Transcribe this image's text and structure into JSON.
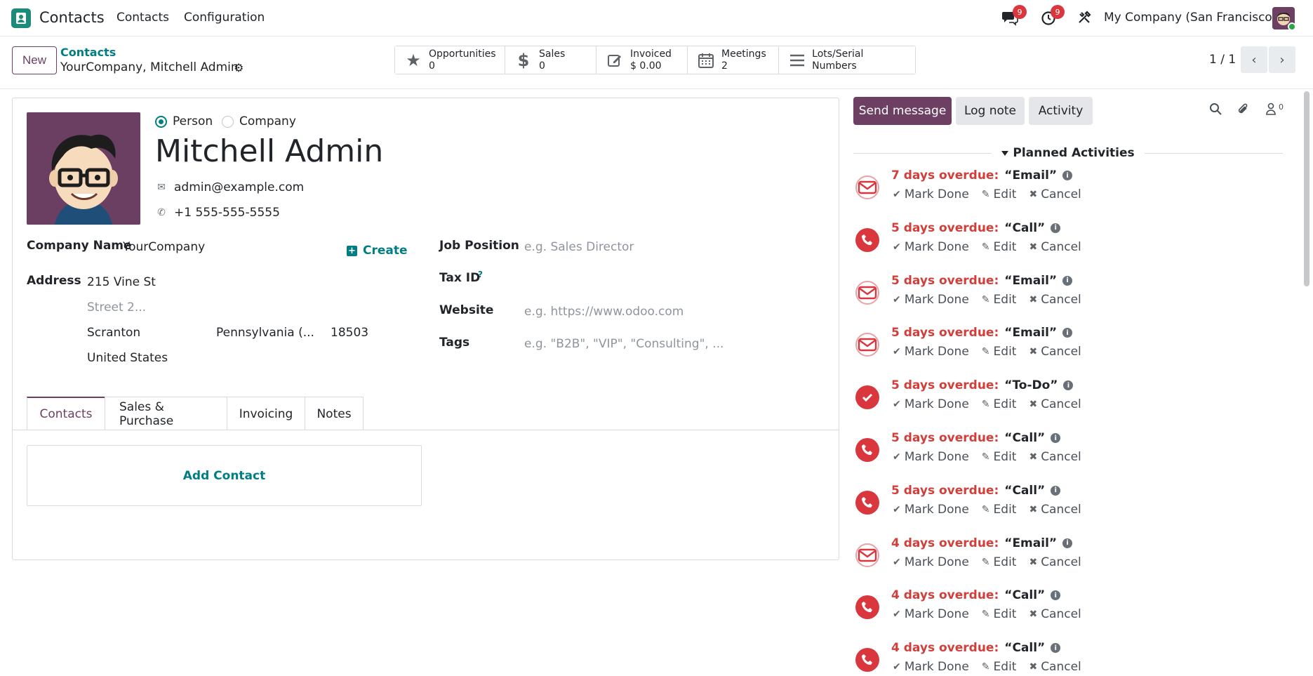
{
  "navbar": {
    "app_name": "Contacts",
    "menu": [
      "Contacts",
      "Configuration"
    ],
    "messages_count": "9",
    "activities_count": "9",
    "company": "My Company (San Francisco)"
  },
  "control_panel": {
    "new_label": "New",
    "breadcrumb_parent": "Contacts",
    "breadcrumb_current": "YourCompany, Mitchell Admin",
    "smart_buttons": [
      {
        "label": "Opportunities",
        "value": "0",
        "icon": "star-icon"
      },
      {
        "label": "Sales",
        "value": "0",
        "icon": "dollar-icon"
      },
      {
        "label": "Invoiced",
        "value": "$ 0.00",
        "icon": "pencil-square-icon"
      },
      {
        "label": "Meetings",
        "value": "2",
        "icon": "calendar-icon"
      },
      {
        "label": "Lots/Serial Numbers",
        "value": "",
        "icon": "bars-icon"
      }
    ],
    "pager": "1 / 1"
  },
  "form": {
    "type_person": "Person",
    "type_company": "Company",
    "selected_type": "Person",
    "name": "Mitchell Admin",
    "email": "admin@example.com",
    "phone": "+1 555-555-5555",
    "company_name_label": "Company Name",
    "company_name": "YourCompany",
    "create_label": "Create",
    "address_label": "Address",
    "street": "215 Vine St",
    "street2_placeholder": "Street 2...",
    "city": "Scranton",
    "state": "Pennsylvania (...",
    "zip": "18503",
    "country": "United States",
    "job_position_label": "Job Position",
    "job_position_placeholder": "e.g. Sales Director",
    "tax_id_label": "Tax ID",
    "tax_id_help": "?",
    "website_label": "Website",
    "website_placeholder": "e.g. https://www.odoo.com",
    "tags_label": "Tags",
    "tags_placeholder": "e.g. \"B2B\", \"VIP\", \"Consulting\", ...",
    "tabs": [
      "Contacts",
      "Sales & Purchase",
      "Invoicing",
      "Notes"
    ],
    "active_tab": "Contacts",
    "add_contact": "Add Contact"
  },
  "chatter": {
    "send_message": "Send message",
    "log_note": "Log note",
    "activity": "Activity",
    "followers_count": "0",
    "planned_title": "Planned Activities",
    "action_mark_done": "Mark Done",
    "action_edit": "Edit",
    "action_cancel": "Cancel",
    "activities": [
      {
        "due": "7 days overdue:",
        "name": "“Email”",
        "type": "email"
      },
      {
        "due": "5 days overdue:",
        "name": "“Call”",
        "type": "call"
      },
      {
        "due": "5 days overdue:",
        "name": "“Email”",
        "type": "email"
      },
      {
        "due": "5 days overdue:",
        "name": "“Email”",
        "type": "email"
      },
      {
        "due": "5 days overdue:",
        "name": "“To-Do”",
        "type": "todo"
      },
      {
        "due": "5 days overdue:",
        "name": "“Call”",
        "type": "call"
      },
      {
        "due": "5 days overdue:",
        "name": "“Call”",
        "type": "call"
      },
      {
        "due": "4 days overdue:",
        "name": "“Email”",
        "type": "email"
      },
      {
        "due": "4 days overdue:",
        "name": "“Call”",
        "type": "call"
      },
      {
        "due": "4 days overdue:",
        "name": "“Call”",
        "type": "call"
      }
    ]
  },
  "colors": {
    "brand": "#6d3f63",
    "link": "#017e84",
    "overdue": "#d23f3a",
    "badge": "#d9363e"
  }
}
